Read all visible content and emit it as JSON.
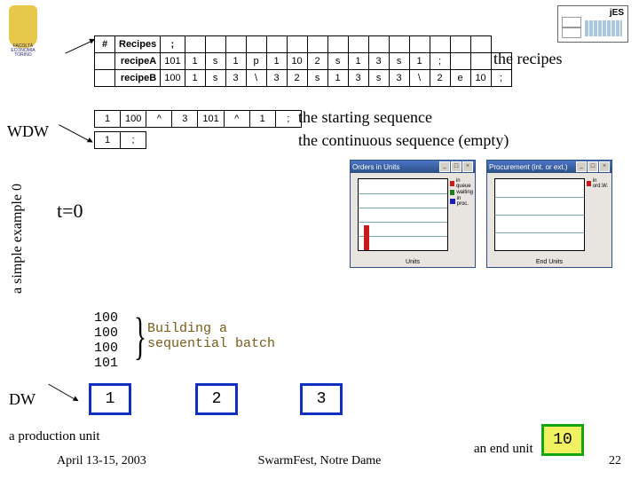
{
  "logos": {
    "crest_caption_l1": "FACOLTÀ",
    "crest_caption_l2": "ECONOMIA",
    "crest_caption_l3": "TORINO",
    "jes_label": "jES"
  },
  "recipes": {
    "header_hash": "#",
    "header_recipes": "Recipes",
    "header_semi": ";",
    "rowA_label": "recipeA",
    "rowA": [
      "101",
      "1",
      "s",
      "1",
      "p",
      "1",
      "10",
      "2",
      "s",
      "1",
      "3",
      "s",
      "1",
      ";"
    ],
    "rowB_label": "recipeB",
    "rowB": [
      "100",
      "1",
      "s",
      "3",
      "\\",
      "3",
      "2",
      "s",
      "1",
      "3",
      "s",
      "3",
      "\\",
      "2",
      "e",
      "10",
      ";"
    ],
    "caption": "the recipes"
  },
  "wdw": {
    "label": "WDW",
    "row1": [
      "1",
      "100",
      "^",
      "3",
      "101",
      "^",
      "1",
      ";"
    ],
    "row2": [
      "1",
      ";"
    ],
    "starting_label": "the starting sequence",
    "continuous_label": "the continuous sequence (empty)"
  },
  "side_label": "a simple example 0",
  "t_equals": "t=0",
  "windows": {
    "w1_title": "Orders in Units",
    "w1_xlabel": "Units",
    "w1_legend": [
      "in queue",
      "waiting",
      "in proc."
    ],
    "w2_title": "Procurement (int. or ext.)",
    "w2_xlabel": "End Units",
    "w2_legend": [
      "in ord.W."
    ]
  },
  "batch": {
    "lines": [
      "100",
      "100",
      "100",
      "101"
    ],
    "text_l1": "Building a",
    "text_l2": "sequential batch"
  },
  "dw": {
    "label": "DW",
    "unit1": "1",
    "unit2": "2",
    "unit3": "3",
    "unit10": "10",
    "prod_label": "a production unit",
    "end_label": "an end unit"
  },
  "footer": {
    "left": "April 13-15, 2003",
    "center": "SwarmFest, Notre Dame",
    "pageno": "22"
  }
}
